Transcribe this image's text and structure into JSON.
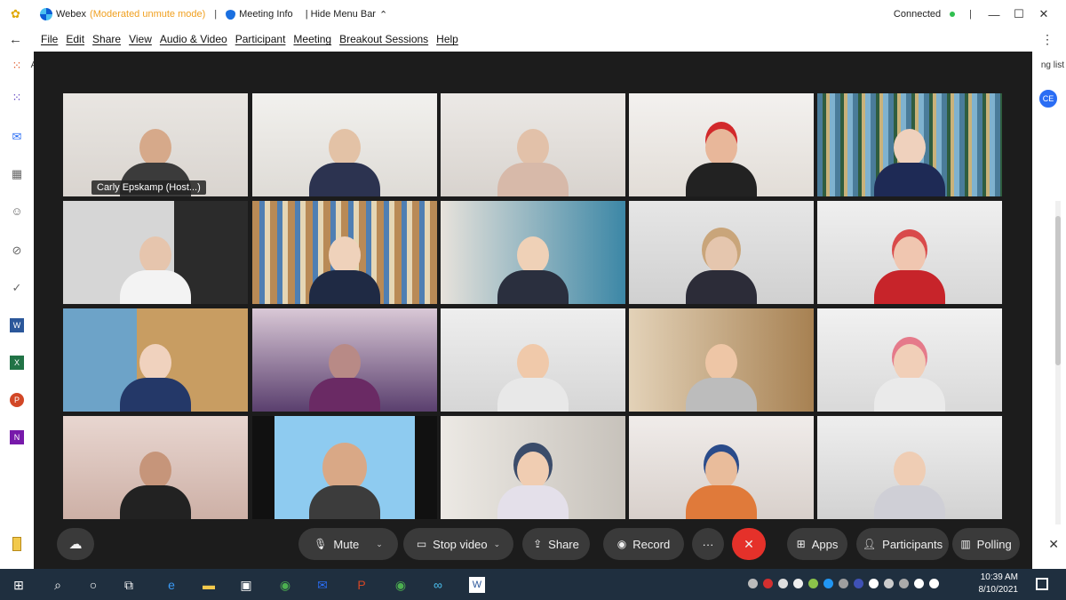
{
  "titlebar": {
    "app_name": "Webex",
    "mode": "(Moderated unmute mode)",
    "separator": "|",
    "meeting_info": "Meeting Info",
    "hide_menu": "| Hide Menu Bar",
    "hide_menu_icon": "chevron-up-icon",
    "status": "Connected",
    "status_color": "#2fbf4f"
  },
  "menu": {
    "items": [
      "File",
      "Edit",
      "Share",
      "View",
      "Audio & Video",
      "Participant",
      "Meeting",
      "Breakout Sessions",
      "Help"
    ]
  },
  "background_app": {
    "right_fragment": "ng list",
    "avatar_initials": "CE",
    "left_fragment": "A"
  },
  "participants": {
    "host_name": "Carly Epskamp  (Host...)"
  },
  "controls": {
    "mute": "Mute",
    "stop_video": "Stop video",
    "share": "Share",
    "record": "Record",
    "more": "···",
    "end": "✕",
    "apps": "Apps",
    "participants": "Participants",
    "polling": "Polling",
    "end_color": "#e5312a"
  },
  "taskbar": {
    "time": "10:39 AM",
    "date": "8/10/2021"
  }
}
